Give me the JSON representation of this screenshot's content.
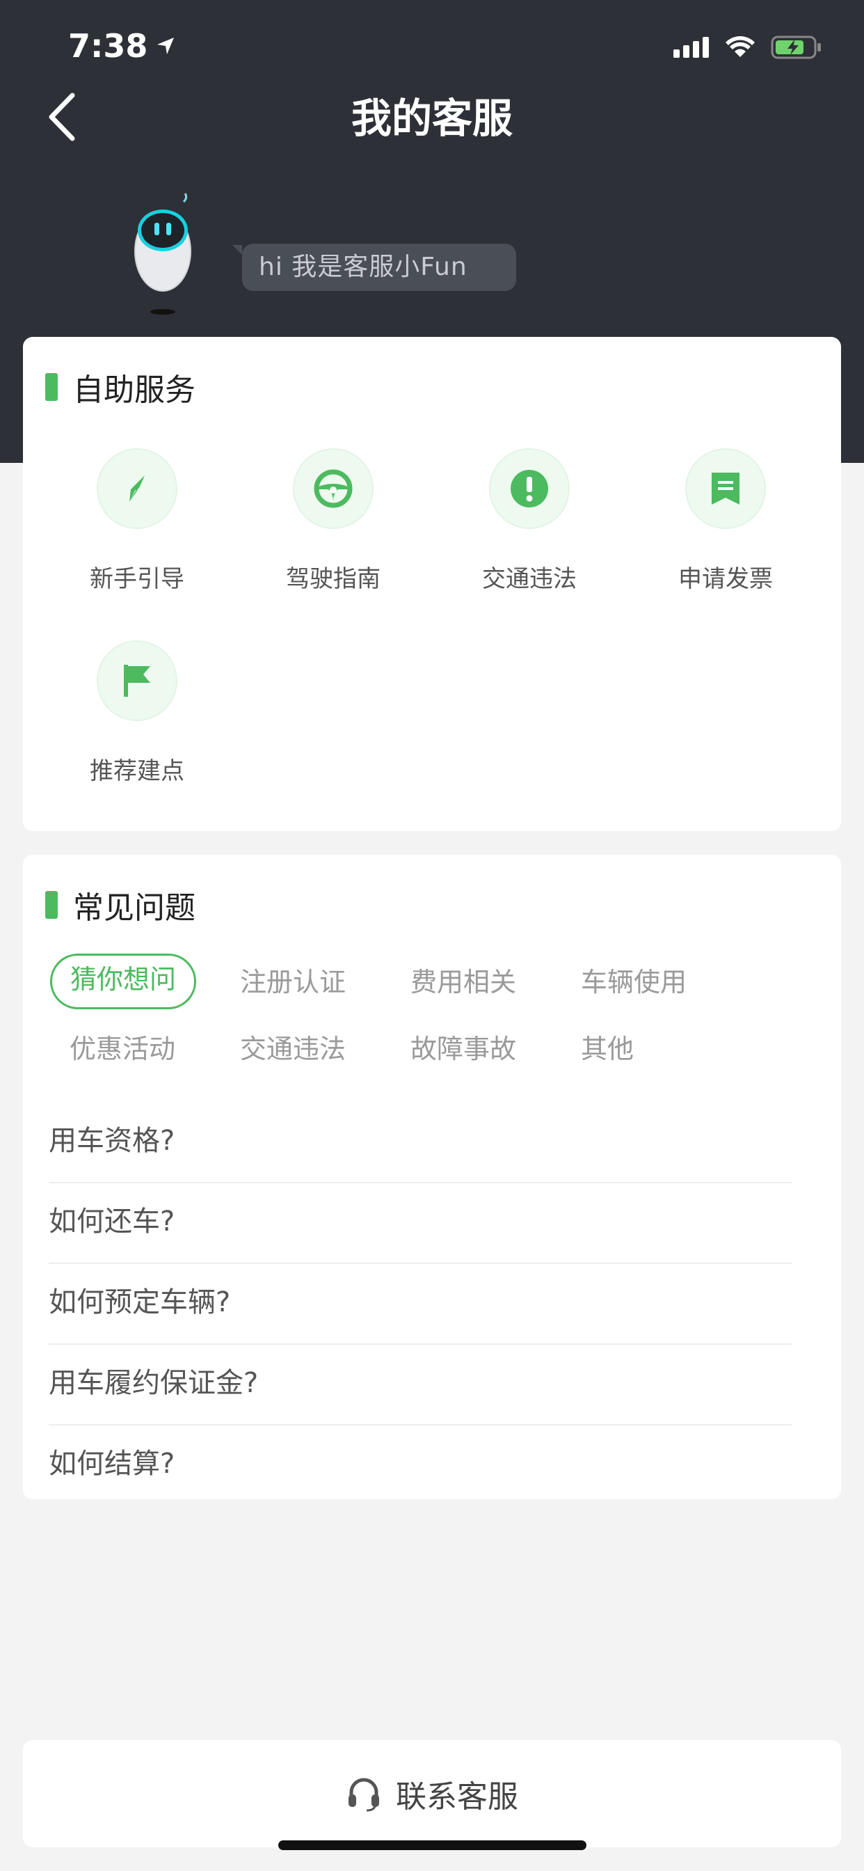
{
  "status_bar": {
    "time": "7:38"
  },
  "nav": {
    "title": "我的客服"
  },
  "greeting": {
    "text": "hi 我是客服小Fun"
  },
  "self_service": {
    "title": "自助服务",
    "items": [
      {
        "label": "新手引导",
        "icon": "compass-icon"
      },
      {
        "label": "驾驶指南",
        "icon": "steering-wheel-icon"
      },
      {
        "label": "交通违法",
        "icon": "exclamation-icon"
      },
      {
        "label": "申请发票",
        "icon": "receipt-icon"
      },
      {
        "label": "推荐建点",
        "icon": "flag-icon"
      }
    ]
  },
  "faq": {
    "title": "常见问题",
    "tags": [
      "猜你想问",
      "注册认证",
      "费用相关",
      "车辆使用",
      "优惠活动",
      "交通违法",
      "故障事故",
      "其他"
    ],
    "active_tag": "猜你想问",
    "questions": [
      "用车资格?",
      "如何还车?",
      "如何预定车辆?",
      "用车履约保证金?",
      "如何结算?"
    ]
  },
  "contact": {
    "label": "联系客服",
    "icon": "headset-icon"
  },
  "colors": {
    "accent": "#4cba5f",
    "header_bg": "#2d3036"
  }
}
